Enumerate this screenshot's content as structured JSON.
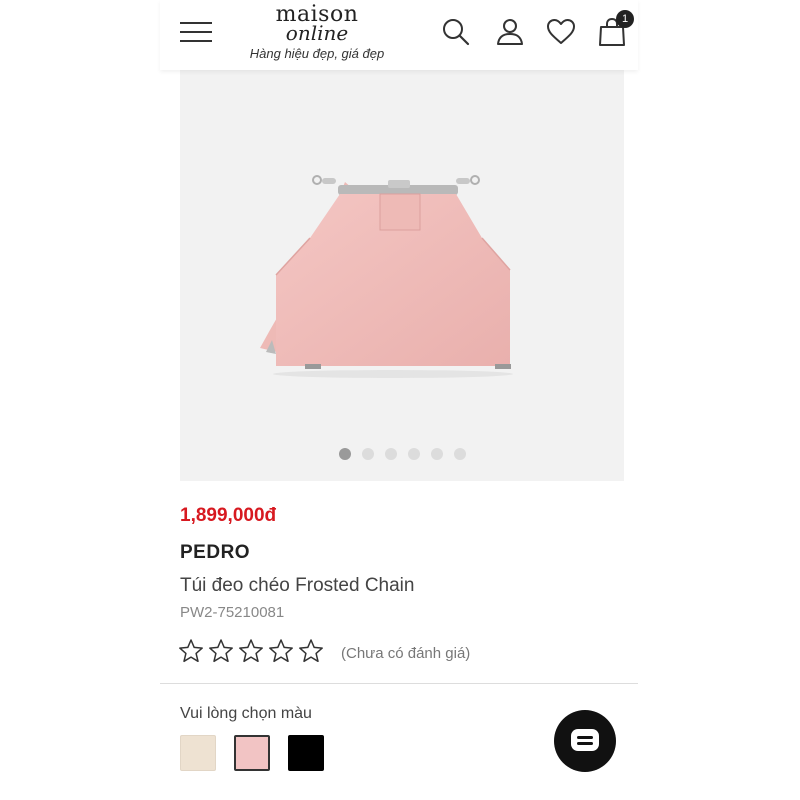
{
  "header": {
    "logo_top": "maison",
    "logo_mid": "online",
    "tagline": "Hàng hiệu đẹp, giá đẹp",
    "cart_count": "1",
    "icons": [
      "menu-icon",
      "search-icon",
      "user-icon",
      "heart-icon",
      "shopping-bag-icon"
    ]
  },
  "gallery": {
    "image": "pink-crossbody-bag-photo",
    "slide_count": 6,
    "active_slide": 1
  },
  "product": {
    "price": "1,899,000đ",
    "brand": "PEDRO",
    "name": "Túi đeo chéo Frosted Chain",
    "sku": "PW2-75210081",
    "rating_stars": 0,
    "max_stars": 5,
    "rating_text": "(Chưa có đánh giá)"
  },
  "colors": {
    "label": "Vui lòng chọn màu",
    "options": [
      {
        "color": "#eee2d2",
        "selected": false
      },
      {
        "color": "#f2c4c4",
        "selected": true
      },
      {
        "color": "#000000",
        "selected": false
      }
    ]
  },
  "theme": {
    "price_color": "#d71920",
    "chat_icon": "chat-icon"
  }
}
